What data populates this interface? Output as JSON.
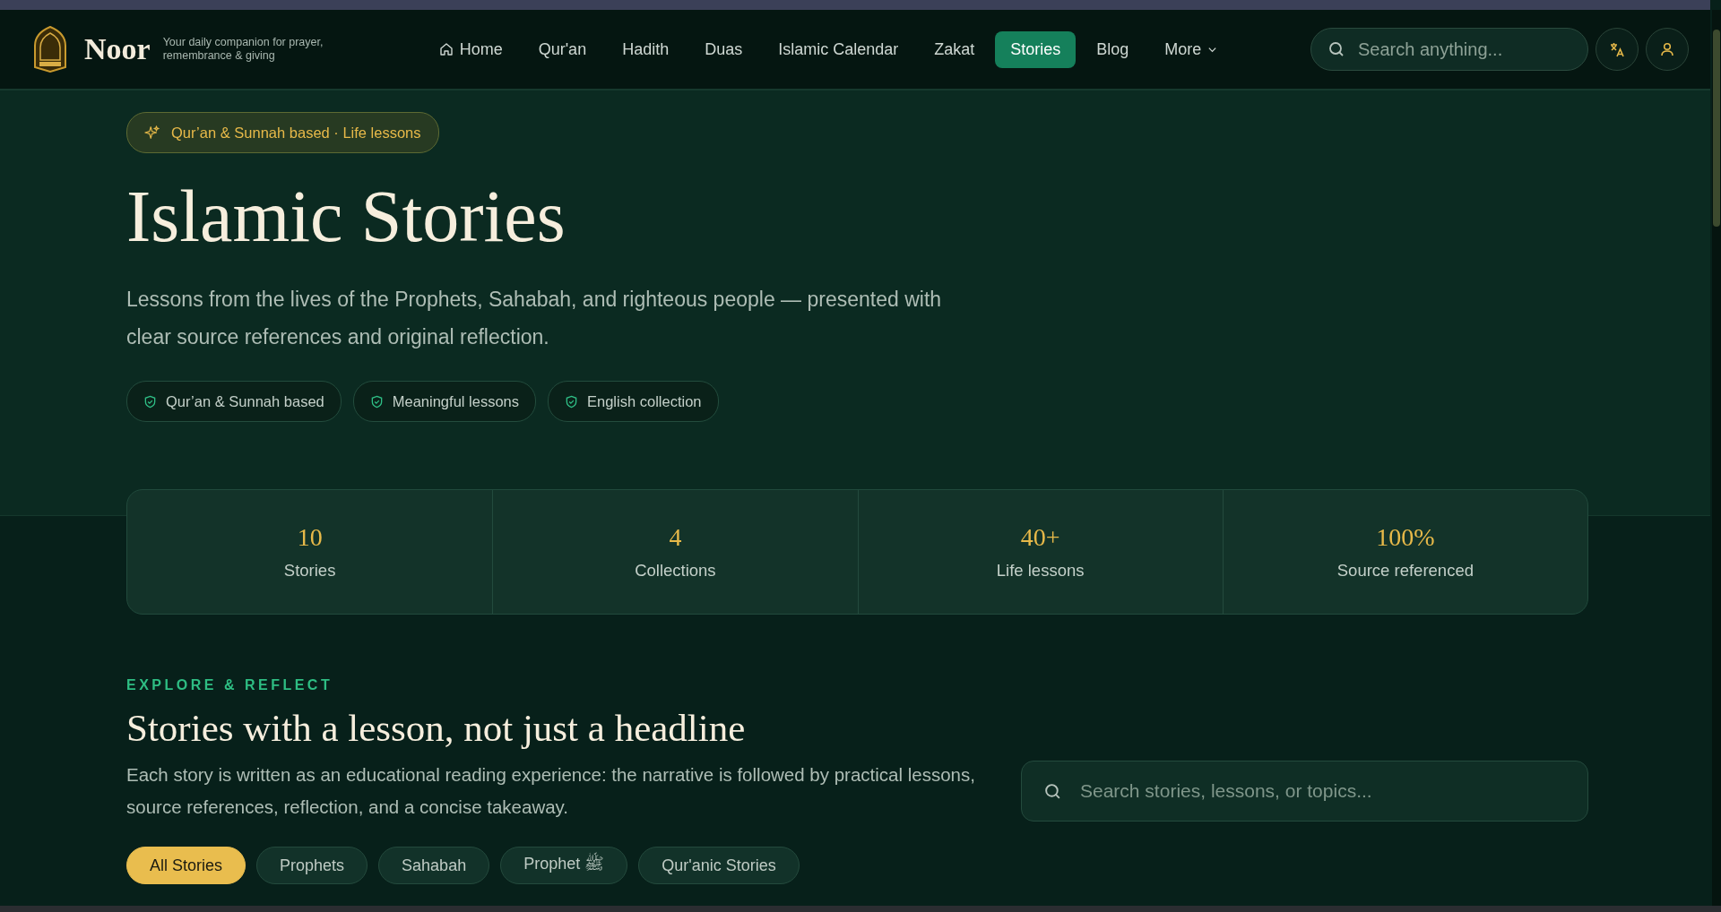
{
  "brand": {
    "name": "Noor",
    "tagline": "Your daily companion for prayer, remembrance & giving"
  },
  "nav": [
    {
      "label": "Home",
      "kind": "home",
      "selected": false
    },
    {
      "label": "Qur'an",
      "selected": false
    },
    {
      "label": "Hadith",
      "selected": false
    },
    {
      "label": "Duas",
      "selected": false
    },
    {
      "label": "Islamic Calendar",
      "selected": false
    },
    {
      "label": "Zakat",
      "selected": false
    },
    {
      "label": "Stories",
      "selected": true
    },
    {
      "label": "Blog",
      "selected": false
    },
    {
      "label": "More",
      "kind": "dropdown",
      "selected": false
    }
  ],
  "search": {
    "placeholder": "Search anything..."
  },
  "hero": {
    "badge": "Qur’an & Sunnah based · Life lessons",
    "title": "Islamic Stories",
    "subtitle": "Lessons from the lives of the Prophets, Sahabah, and righteous people — presented with clear source references and original reflection.",
    "features": [
      "Qur’an & Sunnah based",
      "Meaningful lessons",
      "English collection"
    ]
  },
  "stats": [
    {
      "value": "10",
      "label": "Stories"
    },
    {
      "value": "4",
      "label": "Collections"
    },
    {
      "value": "40+",
      "label": "Life lessons"
    },
    {
      "value": "100%",
      "label": "Source referenced"
    }
  ],
  "section": {
    "eyebrow": "EXPLORE & REFLECT",
    "title": "Stories with a lesson, not just a headline",
    "description": "Each story is written as an educational reading experience: the narrative is followed by practical lessons, source references, reflection, and a concise takeaway.",
    "search_placeholder": "Search stories, lessons, or topics..."
  },
  "filters": [
    {
      "label": "All Stories",
      "selected": true
    },
    {
      "label": "Prophets",
      "selected": false
    },
    {
      "label": "Sahabah",
      "selected": false
    },
    {
      "label": "Prophet ﷺ",
      "selected": false
    },
    {
      "label": "Qur'anic Stories",
      "selected": false
    }
  ]
}
